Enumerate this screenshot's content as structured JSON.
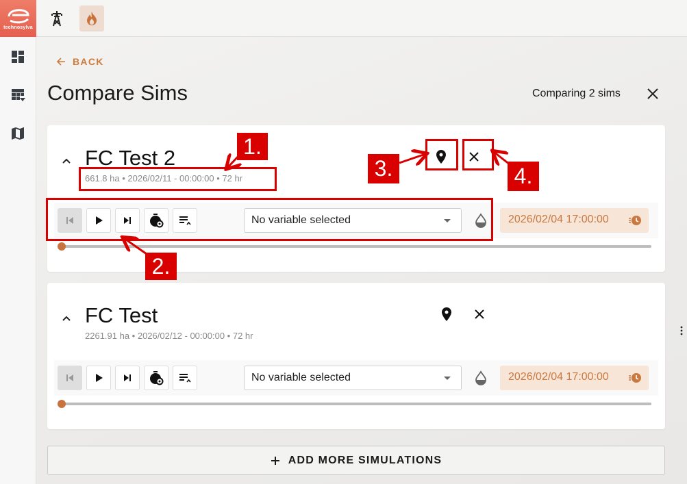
{
  "app": {
    "logo_text": "technosylva"
  },
  "header": {
    "back_label": "BACK",
    "page_title": "Compare Sims",
    "comparing_label": "Comparing 2 sims"
  },
  "sims": [
    {
      "title": "FC Test 2",
      "meta": "661.8 ha • 2026/02/11 - 00:00:00 • 72 hr",
      "variable_select": "No variable selected",
      "time": "2026/02/04 17:00:00",
      "progress": 0
    },
    {
      "title": "FC Test",
      "meta": "2261.91 ha • 2026/02/12 - 00:00:00 • 72 hr",
      "variable_select": "No variable selected",
      "time": "2026/02/04 17:00:00",
      "progress": 0
    }
  ],
  "add_more_label": "ADD MORE SIMULATIONS",
  "annotations": [
    "1.",
    "2.",
    "3.",
    "4."
  ],
  "colors": {
    "accent": "#c9793f",
    "annotation": "#d90000",
    "logo": "#e86a58"
  }
}
